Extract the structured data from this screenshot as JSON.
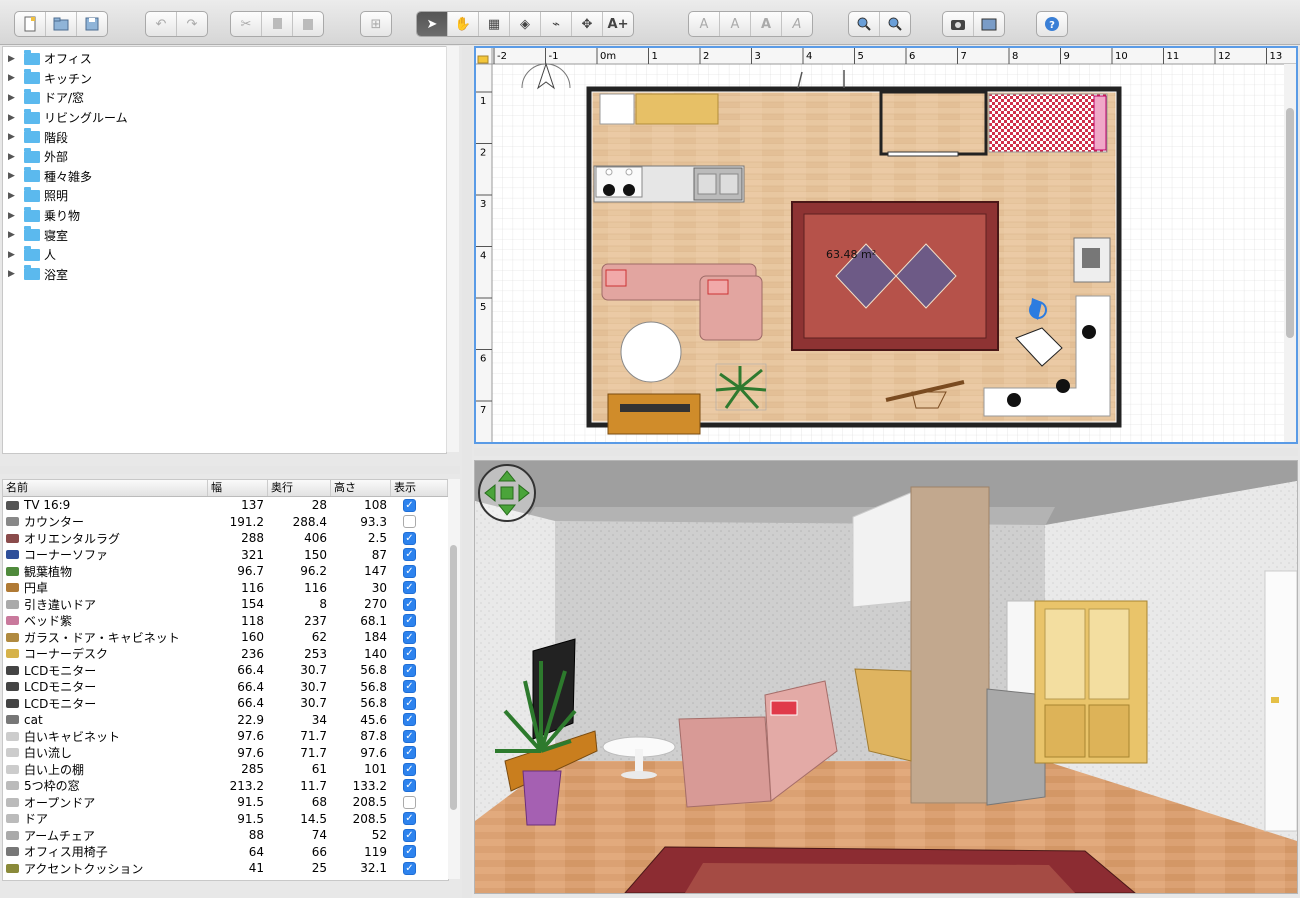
{
  "catalog": {
    "items": [
      {
        "label": "オフィス"
      },
      {
        "label": "キッチン"
      },
      {
        "label": "ドア/窓"
      },
      {
        "label": "リビングルーム"
      },
      {
        "label": "階段"
      },
      {
        "label": "外部"
      },
      {
        "label": "種々雑多"
      },
      {
        "label": "照明"
      },
      {
        "label": "乗り物"
      },
      {
        "label": "寝室"
      },
      {
        "label": "人"
      },
      {
        "label": "浴室"
      }
    ]
  },
  "furniture_table": {
    "columns": [
      "名前",
      "幅",
      "奥行",
      "高さ",
      "表示"
    ],
    "rows": [
      {
        "name": "TV 16:9",
        "w": "137",
        "d": "28",
        "h": "108",
        "visible": true
      },
      {
        "name": "カウンター",
        "w": "191.2",
        "d": "288.4",
        "h": "93.3",
        "visible": false
      },
      {
        "name": "オリエンタルラグ",
        "w": "288",
        "d": "406",
        "h": "2.5",
        "visible": true
      },
      {
        "name": "コーナーソファ",
        "w": "321",
        "d": "150",
        "h": "87",
        "visible": true
      },
      {
        "name": "観葉植物",
        "w": "96.7",
        "d": "96.2",
        "h": "147",
        "visible": true
      },
      {
        "name": "円卓",
        "w": "116",
        "d": "116",
        "h": "30",
        "visible": true
      },
      {
        "name": "引き違いドア",
        "w": "154",
        "d": "8",
        "h": "270",
        "visible": true
      },
      {
        "name": "ベッド紫",
        "w": "118",
        "d": "237",
        "h": "68.1",
        "visible": true
      },
      {
        "name": "ガラス・ドア・キャビネット",
        "w": "160",
        "d": "62",
        "h": "184",
        "visible": true
      },
      {
        "name": "コーナーデスク",
        "w": "236",
        "d": "253",
        "h": "140",
        "visible": true
      },
      {
        "name": "LCDモニター",
        "w": "66.4",
        "d": "30.7",
        "h": "56.8",
        "visible": true
      },
      {
        "name": "LCDモニター",
        "w": "66.4",
        "d": "30.7",
        "h": "56.8",
        "visible": true
      },
      {
        "name": "LCDモニター",
        "w": "66.4",
        "d": "30.7",
        "h": "56.8",
        "visible": true
      },
      {
        "name": "cat",
        "w": "22.9",
        "d": "34",
        "h": "45.6",
        "visible": true
      },
      {
        "name": "白いキャビネット",
        "w": "97.6",
        "d": "71.7",
        "h": "87.8",
        "visible": true
      },
      {
        "name": "白い流し",
        "w": "97.6",
        "d": "71.7",
        "h": "97.6",
        "visible": true
      },
      {
        "name": "白い上の棚",
        "w": "285",
        "d": "61",
        "h": "101",
        "visible": true
      },
      {
        "name": "5つ枠の窓",
        "w": "213.2",
        "d": "11.7",
        "h": "133.2",
        "visible": true
      },
      {
        "name": "オープンドア",
        "w": "91.5",
        "d": "68",
        "h": "208.5",
        "visible": false
      },
      {
        "name": "ドア",
        "w": "91.5",
        "d": "14.5",
        "h": "208.5",
        "visible": true
      },
      {
        "name": "アームチェア",
        "w": "88",
        "d": "74",
        "h": "52",
        "visible": true
      },
      {
        "name": "オフィス用椅子",
        "w": "64",
        "d": "66",
        "h": "119",
        "visible": true
      },
      {
        "name": "アクセントクッション",
        "w": "41",
        "d": "25",
        "h": "32.1",
        "visible": true
      }
    ]
  },
  "plan": {
    "ruler_x": [
      "-2",
      "-1",
      "0m",
      "1",
      "2",
      "3",
      "4",
      "5",
      "6",
      "7",
      "8",
      "9",
      "10",
      "11",
      "12",
      "13"
    ],
    "ruler_y": [
      "1",
      "2",
      "3",
      "4",
      "5",
      "6",
      "7"
    ],
    "room_area": "63.48 m²"
  }
}
